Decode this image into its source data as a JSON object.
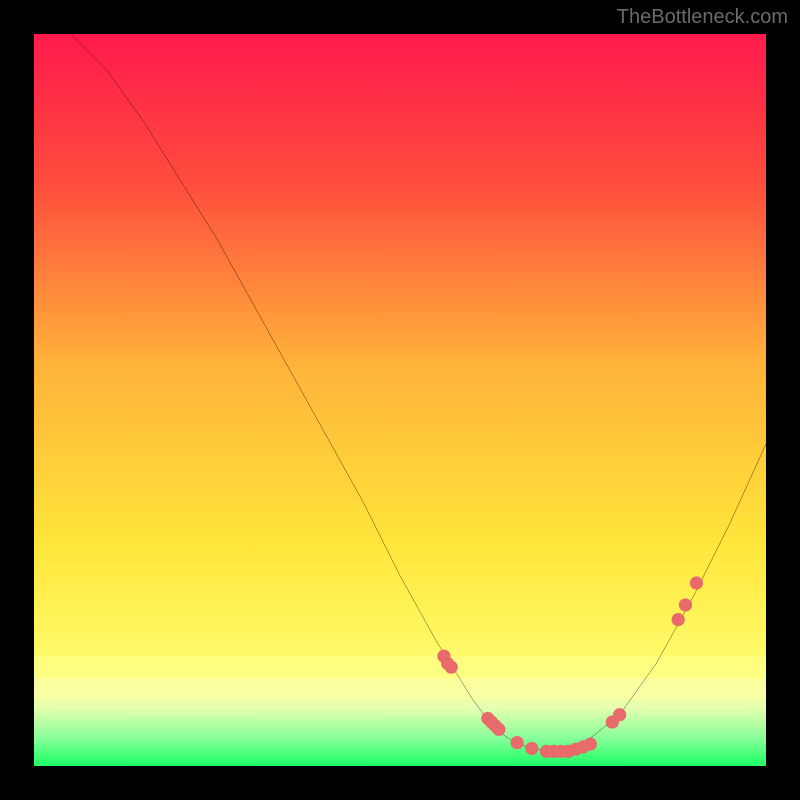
{
  "watermark": "TheBottleneck.com",
  "chart_data": {
    "type": "line",
    "title": "",
    "xlabel": "",
    "ylabel": "",
    "xlim": [
      0,
      100
    ],
    "ylim": [
      0,
      100
    ],
    "curve": {
      "x": [
        5,
        10,
        15,
        20,
        25,
        30,
        35,
        40,
        45,
        50,
        55,
        60,
        63,
        66,
        70,
        75,
        80,
        85,
        90,
        95,
        100
      ],
      "y": [
        100,
        95,
        88,
        80,
        72,
        63,
        54,
        45,
        36,
        26,
        17,
        9,
        5,
        3,
        2,
        3,
        7,
        14,
        23,
        33,
        44
      ]
    },
    "series": [
      {
        "name": "markers",
        "x": [
          56,
          56.5,
          57,
          62,
          62.5,
          63,
          63.5,
          66,
          68,
          70,
          71,
          72,
          73,
          74,
          75,
          76,
          79,
          80,
          88,
          89,
          90.5
        ],
        "y": [
          15,
          14,
          13.5,
          6.5,
          6,
          5.5,
          5,
          3.2,
          2.4,
          2,
          2,
          2,
          2,
          2.3,
          2.6,
          3,
          6,
          7,
          20,
          22,
          25
        ]
      }
    ],
    "gradient_stops": [
      {
        "pos": 0.0,
        "color": "#ff1a4d"
      },
      {
        "pos": 0.2,
        "color": "#ff4b3d"
      },
      {
        "pos": 0.45,
        "color": "#ffb23a"
      },
      {
        "pos": 0.7,
        "color": "#ffe63a"
      },
      {
        "pos": 0.85,
        "color": "#fffb6a"
      },
      {
        "pos": 0.88,
        "color": "#f8ff8a"
      },
      {
        "pos": 0.92,
        "color": "#e6ffb0"
      },
      {
        "pos": 0.96,
        "color": "#8cff9a"
      },
      {
        "pos": 1.0,
        "color": "#1aff66"
      }
    ],
    "bands": [
      {
        "top_pct": 85,
        "height_pct": 3,
        "color": "rgba(255,255,130,0.75)"
      },
      {
        "top_pct": 88,
        "height_pct": 3,
        "color": "rgba(255,255,170,0.55)"
      }
    ]
  }
}
